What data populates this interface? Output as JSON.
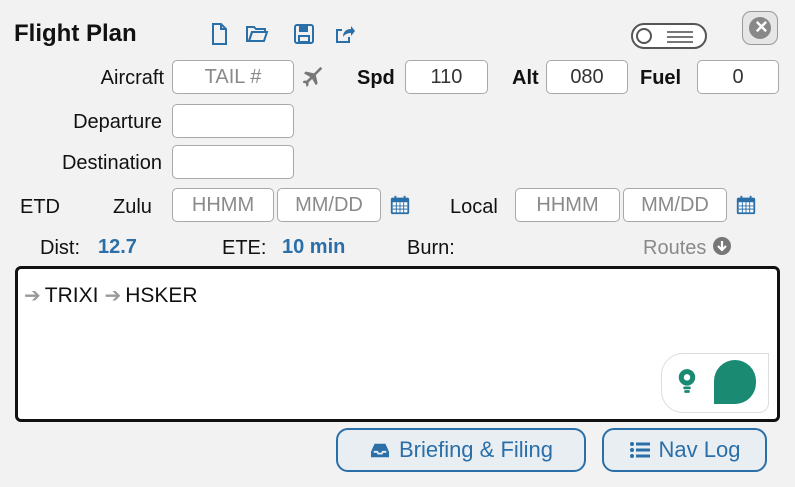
{
  "header": {
    "title": "Flight Plan",
    "icons": [
      "new-file-icon",
      "open-folder-icon",
      "save-icon",
      "share-icon"
    ],
    "toggle_icon": "list-toggle-icon",
    "close_icon": "close-icon"
  },
  "aircraft": {
    "label": "Aircraft",
    "tail_placeholder": "TAIL #",
    "speed_label": "Spd",
    "speed_value": "110",
    "alt_label": "Alt",
    "alt_value": "080",
    "fuel_label": "Fuel",
    "fuel_value": "0"
  },
  "departure": {
    "label": "Departure",
    "value": ""
  },
  "destination": {
    "label": "Destination",
    "value": ""
  },
  "etd": {
    "label": "ETD",
    "zulu_label": "Zulu",
    "zulu_time_placeholder": "HHMM",
    "zulu_date_placeholder": "MM/DD",
    "local_label": "Local",
    "local_time_placeholder": "HHMM",
    "local_date_placeholder": "MM/DD"
  },
  "summary": {
    "dist_label": "Dist:",
    "dist_value": "12.7",
    "ete_label": "ETE:",
    "ete_value": "10 min",
    "burn_label": "Burn:",
    "burn_value": "",
    "routes_label": "Routes"
  },
  "route": {
    "waypoints": [
      "TRIXI",
      "HSKER"
    ]
  },
  "buttons": {
    "briefing_label": "Briefing & Filing",
    "navlog_label": "Nav Log"
  },
  "colors": {
    "accent": "#2a6fa8",
    "teal": "#1a8a72"
  }
}
